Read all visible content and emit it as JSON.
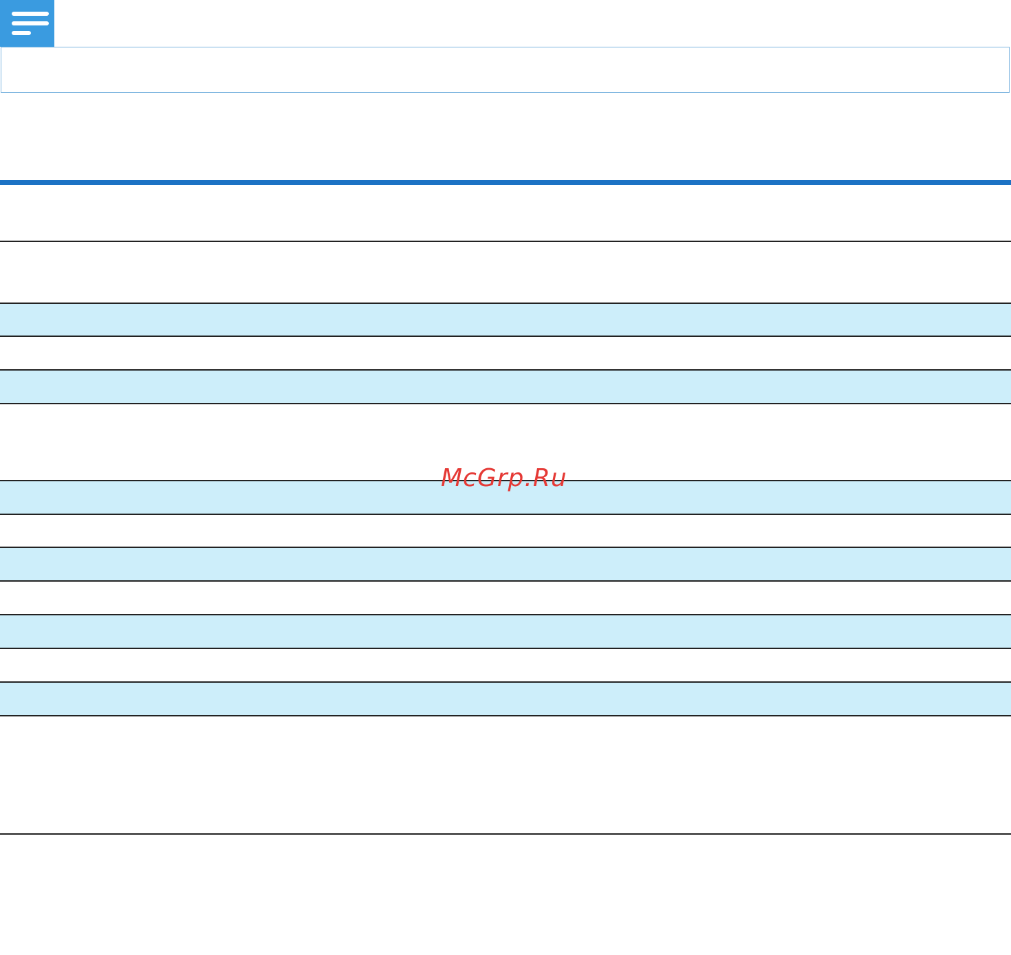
{
  "note": {
    "icon": "note-lines-icon",
    "icon_color": "#3a9be0",
    "border_color": "#7fb6e0",
    "text": ""
  },
  "accent_rule_color": "#1c72c4",
  "table": {
    "row_tint": "#cdeefa",
    "rows": [
      {
        "tinted": false,
        "text": ""
      },
      {
        "tinted": true,
        "text": ""
      },
      {
        "tinted": false,
        "text": ""
      },
      {
        "tinted": true,
        "text": ""
      },
      {
        "tinted": false,
        "text": ""
      },
      {
        "tinted": true,
        "text": ""
      },
      {
        "tinted": false,
        "text": ""
      },
      {
        "tinted": true,
        "text": ""
      },
      {
        "tinted": false,
        "text": ""
      },
      {
        "tinted": true,
        "text": ""
      },
      {
        "tinted": false,
        "text": ""
      },
      {
        "tinted": true,
        "text": ""
      },
      {
        "tinted": false,
        "text": ""
      },
      {
        "tinted": true,
        "text": ""
      }
    ]
  },
  "watermark": {
    "text": "McGrp.Ru",
    "color": "#e53935"
  }
}
